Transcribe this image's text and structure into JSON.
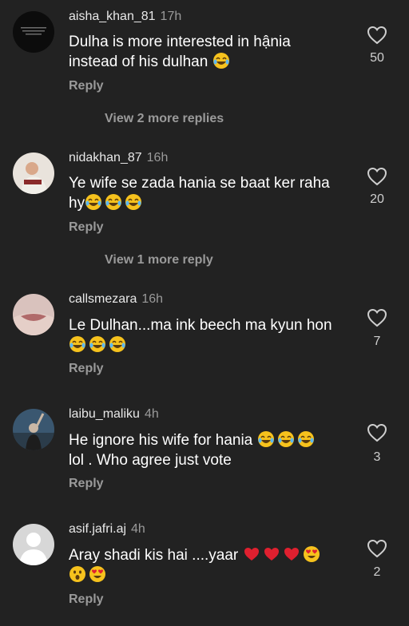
{
  "comments": [
    {
      "username": "aisha_khan_81",
      "time": "17h",
      "text_parts": [
        "Dulha is more interested in hậnia",
        "instead of his dulhan"
      ],
      "emojis": [
        "laughing-tears"
      ],
      "reply_label": "Reply",
      "likes": "50",
      "view_more": "View 2 more replies",
      "avatar_caption": "the art of listening to listening ...\nthe quietest ..."
    },
    {
      "username": "nidakhan_87",
      "time": "16h",
      "text_parts": [
        "Ye wife se zada hania se baat ker raha",
        "hy"
      ],
      "emojis": [
        "laughing-tears",
        "laughing-tears",
        "laughing-tears"
      ],
      "reply_label": "Reply",
      "likes": "20",
      "view_more": "View 1 more reply"
    },
    {
      "username": "callsmezara",
      "time": "16h",
      "text_parts": [
        "Le Dulhan...ma ink beech ma kyun hon"
      ],
      "emojis": [
        "laughing-tears",
        "laughing-tears",
        "laughing-tears"
      ],
      "reply_label": "Reply",
      "likes": "7"
    },
    {
      "username": "laibu_maliku",
      "time": "4h",
      "text_parts": [
        "He ignore his wife for hania",
        "lol . Who agree just vote"
      ],
      "emojis": [
        "laughing-tears",
        "laughing-tears",
        "laughing-tears"
      ],
      "reply_label": "Reply",
      "likes": "3"
    },
    {
      "username": "asif.jafri.aj",
      "time": "4h",
      "text_parts": [
        "Aray shadi kis hai ....yaar"
      ],
      "emojis": [
        "red-heart",
        "red-heart",
        "red-heart",
        "heart-eyes",
        "astonished",
        "heart-eyes"
      ],
      "reply_label": "Reply",
      "likes": "2"
    }
  ],
  "colors": {
    "background": "#222222",
    "username": "#e8e8e8",
    "muted": "#9a9a9a",
    "text": "#ffffff"
  }
}
